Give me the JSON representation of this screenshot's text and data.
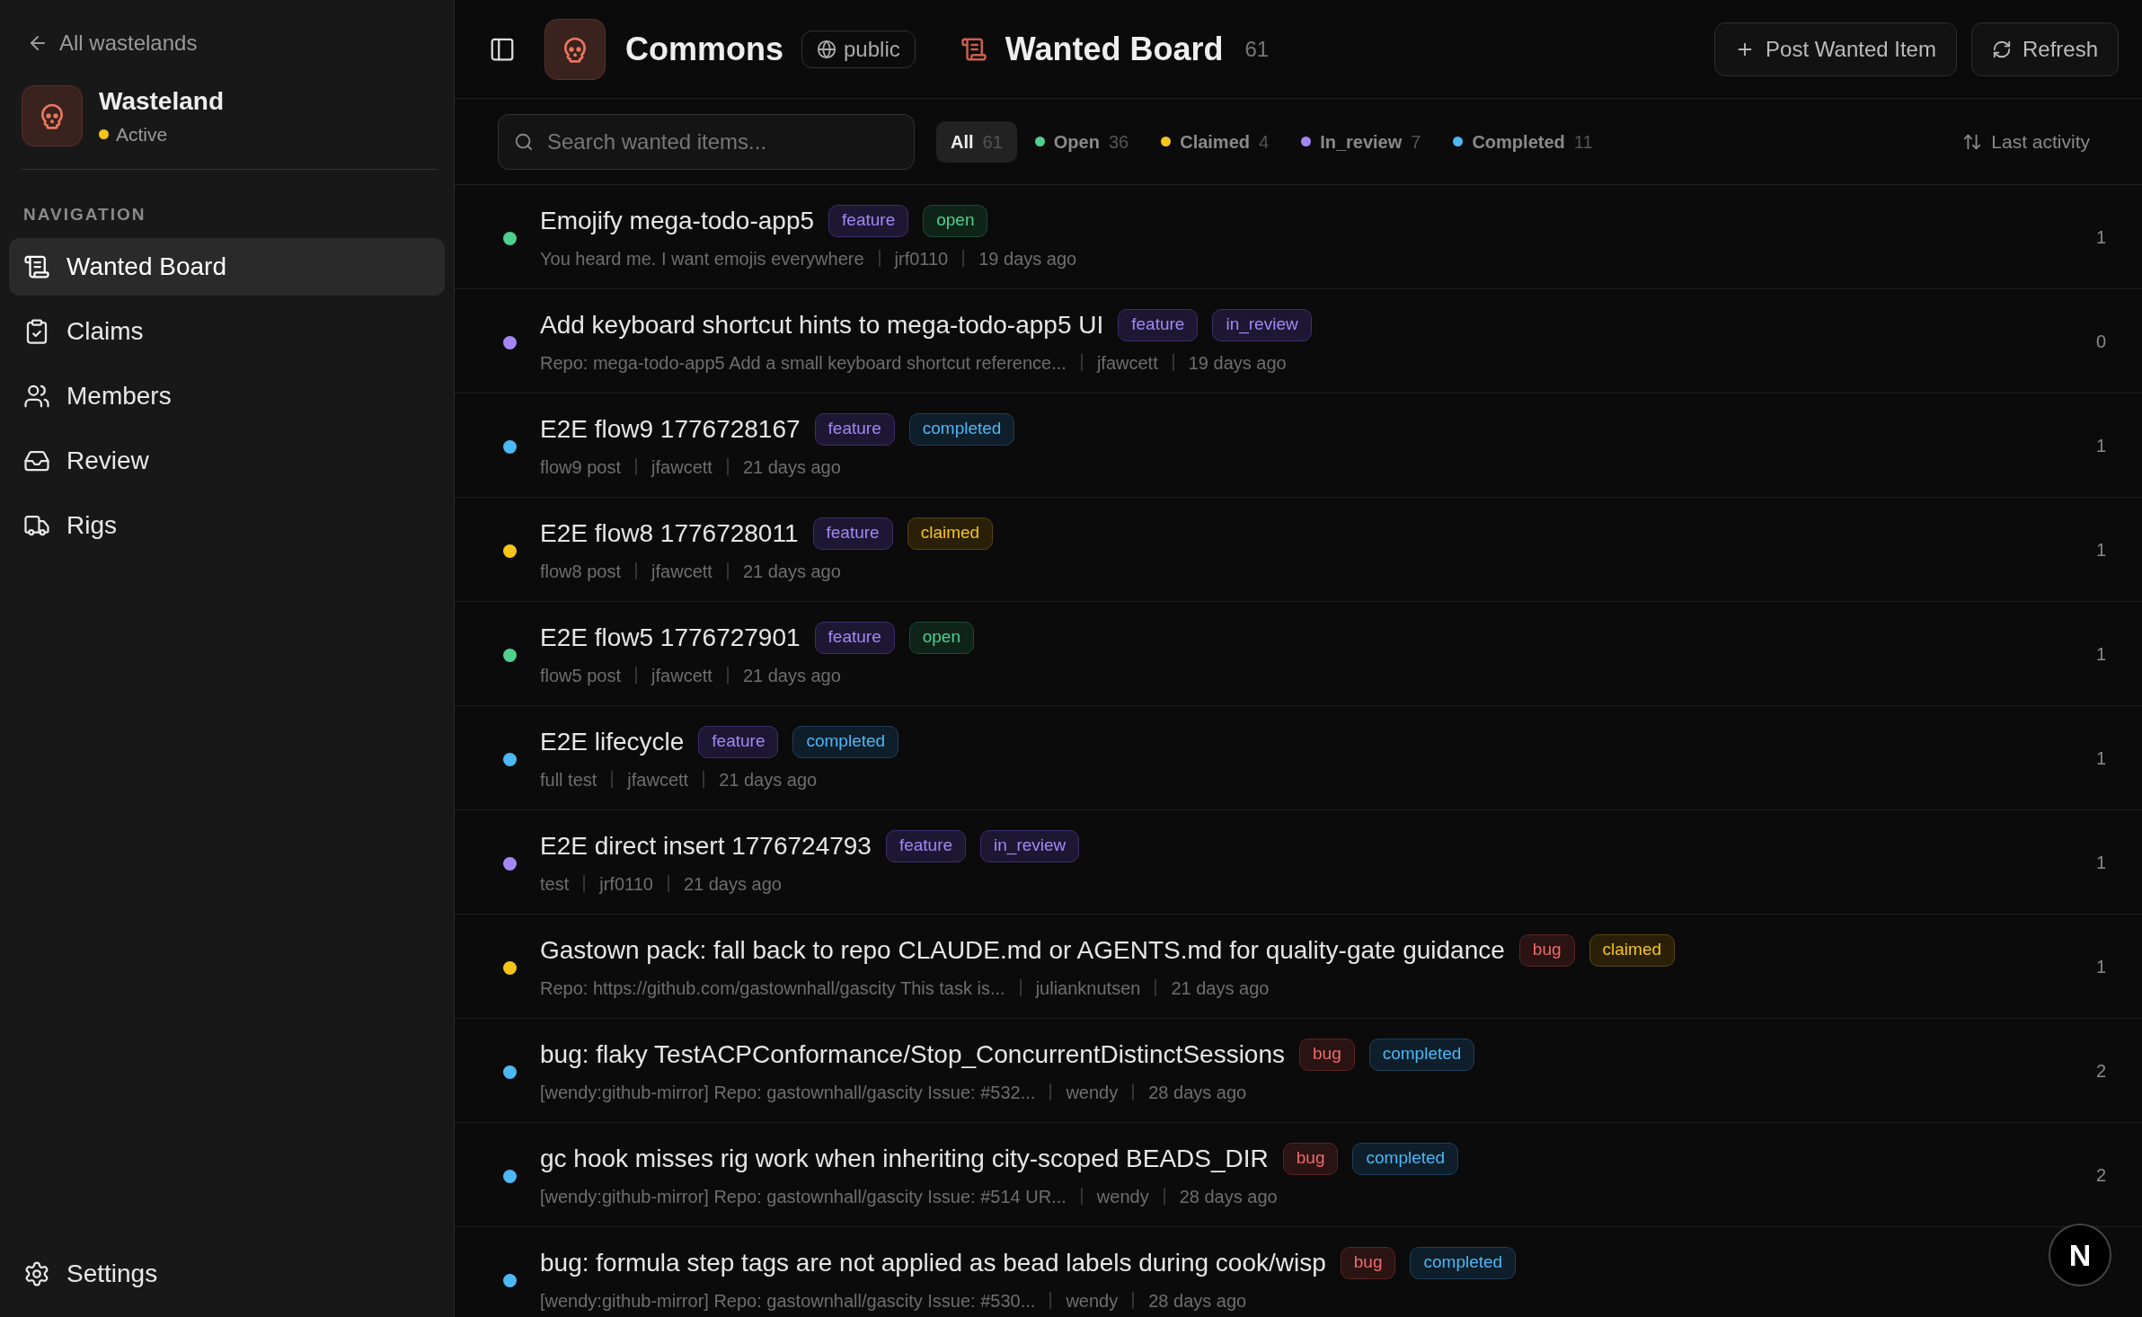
{
  "sidebar": {
    "back_link": "All wastelands",
    "workspace": {
      "name": "Wasteland",
      "status": "Active",
      "color": "#f5c518"
    },
    "section_label": "NAVIGATION",
    "items": [
      {
        "label": "Wanted Board",
        "kind": "board",
        "selected": true
      },
      {
        "label": "Claims",
        "kind": "claims",
        "selected": false
      },
      {
        "label": "Members",
        "kind": "members",
        "selected": false
      },
      {
        "label": "Review",
        "kind": "review",
        "selected": false
      },
      {
        "label": "Rigs",
        "kind": "rigs",
        "selected": false
      }
    ],
    "footer_item": {
      "label": "Settings"
    }
  },
  "header": {
    "community": "Commons",
    "visibility": "public",
    "title": "Wanted Board",
    "count": "61",
    "buttons": [
      {
        "label": "Post Wanted Item",
        "kind": "add"
      },
      {
        "label": "Refresh",
        "kind": "refresh"
      }
    ]
  },
  "filters": {
    "search_placeholder": "Search wanted items...",
    "chips": [
      {
        "label": "All",
        "count": "61",
        "selected": true
      },
      {
        "label": "Open",
        "count": "36",
        "selected": false,
        "color": "#4fd08f"
      },
      {
        "label": "Claimed",
        "count": "4",
        "selected": false,
        "color": "#f5c518"
      },
      {
        "label": "In_review",
        "count": "7",
        "selected": false,
        "color": "#a487f5"
      },
      {
        "label": "Completed",
        "count": "11",
        "selected": false,
        "color": "#4cb8f5"
      }
    ],
    "sort": "Last activity"
  },
  "rows": [
    {
      "title": "Emojify mega-todo-app5",
      "kind": "open",
      "tags": [
        {
          "label": "feature",
          "kind": "feature"
        },
        {
          "label": "open",
          "kind": "open"
        }
      ],
      "description": "You heard me. I want emojis everywhere",
      "author": "jrf0110",
      "time": "19 days ago",
      "count": "1"
    },
    {
      "title": "Add keyboard shortcut hints to mega-todo-app5 UI",
      "kind": "in_review",
      "tags": [
        {
          "label": "feature",
          "kind": "feature"
        },
        {
          "label": "in_review",
          "kind": "in_review"
        }
      ],
      "description": "Repo: mega-todo-app5 Add a small keyboard shortcut reference...",
      "author": "jfawcett",
      "time": "19 days ago",
      "count": "0"
    },
    {
      "title": "E2E flow9 1776728167",
      "kind": "completed",
      "tags": [
        {
          "label": "feature",
          "kind": "feature"
        },
        {
          "label": "completed",
          "kind": "completed"
        }
      ],
      "description": "flow9 post",
      "author": "jfawcett",
      "time": "21 days ago",
      "count": "1"
    },
    {
      "title": "E2E flow8 1776728011",
      "kind": "claimed",
      "tags": [
        {
          "label": "feature",
          "kind": "feature"
        },
        {
          "label": "claimed",
          "kind": "claimed"
        }
      ],
      "description": "flow8 post",
      "author": "jfawcett",
      "time": "21 days ago",
      "count": "1"
    },
    {
      "title": "E2E flow5 1776727901",
      "kind": "open",
      "tags": [
        {
          "label": "feature",
          "kind": "feature"
        },
        {
          "label": "open",
          "kind": "open"
        }
      ],
      "description": "flow5 post",
      "author": "jfawcett",
      "time": "21 days ago",
      "count": "1"
    },
    {
      "title": "E2E lifecycle",
      "kind": "completed",
      "tags": [
        {
          "label": "feature",
          "kind": "feature"
        },
        {
          "label": "completed",
          "kind": "completed"
        }
      ],
      "description": "full test",
      "author": "jfawcett",
      "time": "21 days ago",
      "count": "1"
    },
    {
      "title": "E2E direct insert 1776724793",
      "kind": "in_review",
      "tags": [
        {
          "label": "feature",
          "kind": "feature"
        },
        {
          "label": "in_review",
          "kind": "in_review"
        }
      ],
      "description": "test",
      "author": "jrf0110",
      "time": "21 days ago",
      "count": "1"
    },
    {
      "title": "Gastown pack: fall back to repo CLAUDE.md or AGENTS.md for quality-gate guidance",
      "kind": "claimed",
      "tags": [
        {
          "label": "bug",
          "kind": "bug"
        },
        {
          "label": "claimed",
          "kind": "claimed"
        }
      ],
      "description": "Repo: https://github.com/gastownhall/gascity This task is...",
      "author": "julianknutsen",
      "time": "21 days ago",
      "count": "1"
    },
    {
      "title": "bug: flaky TestACPConformance/Stop_ConcurrentDistinctSessions",
      "kind": "completed",
      "tags": [
        {
          "label": "bug",
          "kind": "bug"
        },
        {
          "label": "completed",
          "kind": "completed"
        }
      ],
      "description": "[wendy:github-mirror] Repo: gastownhall/gascity Issue: #532...",
      "author": "wendy",
      "time": "28 days ago",
      "count": "2"
    },
    {
      "title": "gc hook misses rig work when inheriting city-scoped BEADS_DIR",
      "kind": "completed",
      "tags": [
        {
          "label": "bug",
          "kind": "bug"
        },
        {
          "label": "completed",
          "kind": "completed"
        }
      ],
      "description": "[wendy:github-mirror] Repo: gastownhall/gascity Issue: #514 UR...",
      "author": "wendy",
      "time": "28 days ago",
      "count": "2"
    },
    {
      "title": "bug: formula step tags are not applied as bead labels during cook/wisp",
      "kind": "completed",
      "tags": [
        {
          "label": "bug",
          "kind": "bug"
        },
        {
          "label": "completed",
          "kind": "completed"
        }
      ],
      "description": "[wendy:github-mirror] Repo: gastownhall/gascity Issue: #530...",
      "author": "wendy",
      "time": "28 days ago"
    }
  ],
  "floating_badge": "N"
}
